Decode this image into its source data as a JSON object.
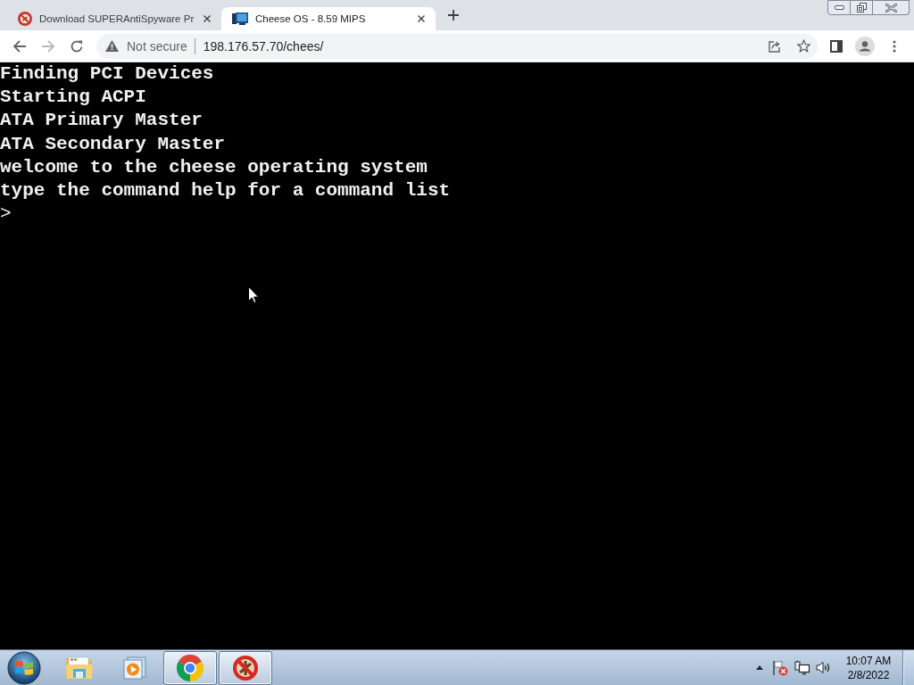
{
  "browser": {
    "tabs": [
      {
        "title": "Download SUPERAntiSpyware Pr",
        "selected": false
      },
      {
        "title": "Cheese OS - 8.59 MIPS",
        "selected": true
      }
    ],
    "toolbar": {
      "forward_disabled": true,
      "security_label": "Not secure",
      "url": "198.176.57.70/chees/"
    }
  },
  "terminal": {
    "lines": [
      "Finding PCI Devices",
      "Starting ACPI",
      "ATA Primary Master",
      "ATA Secondary Master",
      "welcome to the cheese operating system",
      "type the command help for a command list"
    ],
    "prompt": ">"
  },
  "taskbar": {
    "apps": [
      {
        "kind": "folder",
        "running": false
      },
      {
        "kind": "media",
        "running": false
      },
      {
        "kind": "browser",
        "running": true
      },
      {
        "kind": "blocked",
        "running": true
      }
    ],
    "clock": {
      "time": "10:07 AM",
      "date": "2/8/2022"
    }
  }
}
